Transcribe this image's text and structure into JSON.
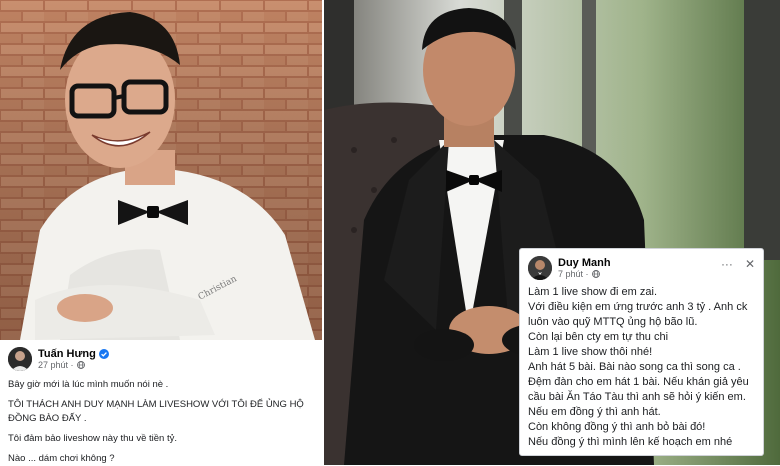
{
  "posts": {
    "left": {
      "author": "Tuấn Hưng",
      "time": "27 phút ·",
      "lines": [
        "Bây giờ mới là lúc mình muốn nói nè .",
        "TÔI THÁCH ANH DUY MẠNH LÀM LIVESHOW VỚI TÔI ĐỂ ỦNG HỘ ĐỒNG BÀO ĐẤY .",
        "Tôi đảm bảo liveshow này thu về tiền tỷ.",
        "Nào ... dám chơi không ?"
      ]
    },
    "right": {
      "author": "Duy Manh",
      "time": "7 phút ·",
      "more": "···",
      "close": "✕",
      "lines": [
        "Làm 1 live show đi em zai.",
        " Với điều kiện em ứng trước anh 3 tỷ . Anh ck luôn vào quỹ MTTQ ủng hộ bão lũ.",
        "Còn lại bên cty em tự thu chi",
        " Làm 1 live show thôi nhé!",
        "Anh  hát 5 bài. Bài nào song ca thì song ca . Đệm đàn cho em hát 1 bài. Nếu khán giả yêu cầu bài Ăn Táo Tàu thì anh sẽ hỏi ý kiến em. Nếu em đồng ý thì anh hát.",
        "Còn không đồng ý thì anh bỏ bài đó!",
        "Nếu đồng ý thì mình lên kế hoạch em nhé"
      ]
    }
  },
  "colors": {
    "verified": "#1877f2",
    "text": "#1c1e21",
    "meta": "#65676b"
  }
}
